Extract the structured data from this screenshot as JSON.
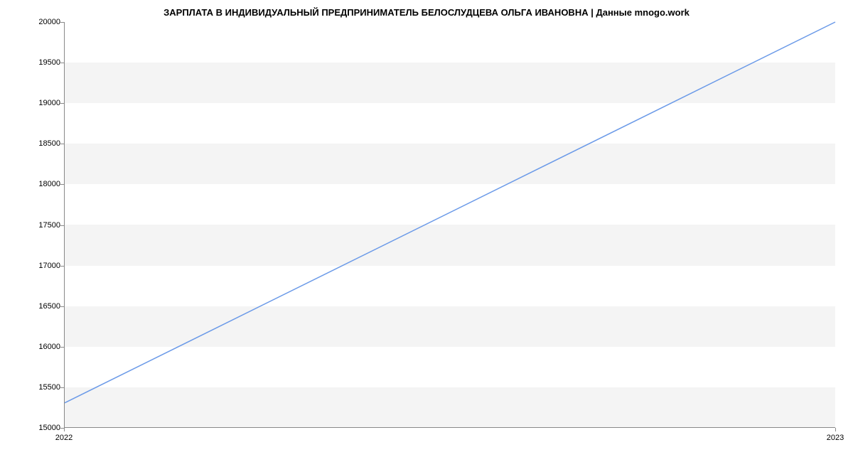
{
  "chart_data": {
    "type": "line",
    "title": "ЗАРПЛАТА В ИНДИВИДУАЛЬНЫЙ ПРЕДПРИНИМАТЕЛЬ БЕЛОСЛУДЦЕВА ОЛЬГА ИВАНОВНА | Данные mnogo.work",
    "x": [
      2022,
      2023
    ],
    "values": [
      15300,
      20000
    ],
    "xlabel": "",
    "ylabel": "",
    "x_ticks": [
      2022,
      2023
    ],
    "y_ticks": [
      15000,
      15500,
      16000,
      16500,
      17000,
      17500,
      18000,
      18500,
      19000,
      19500,
      20000
    ],
    "xlim": [
      2022,
      2023
    ],
    "ylim": [
      15000,
      20000
    ],
    "line_color": "#6b9ae8",
    "grid": true
  }
}
